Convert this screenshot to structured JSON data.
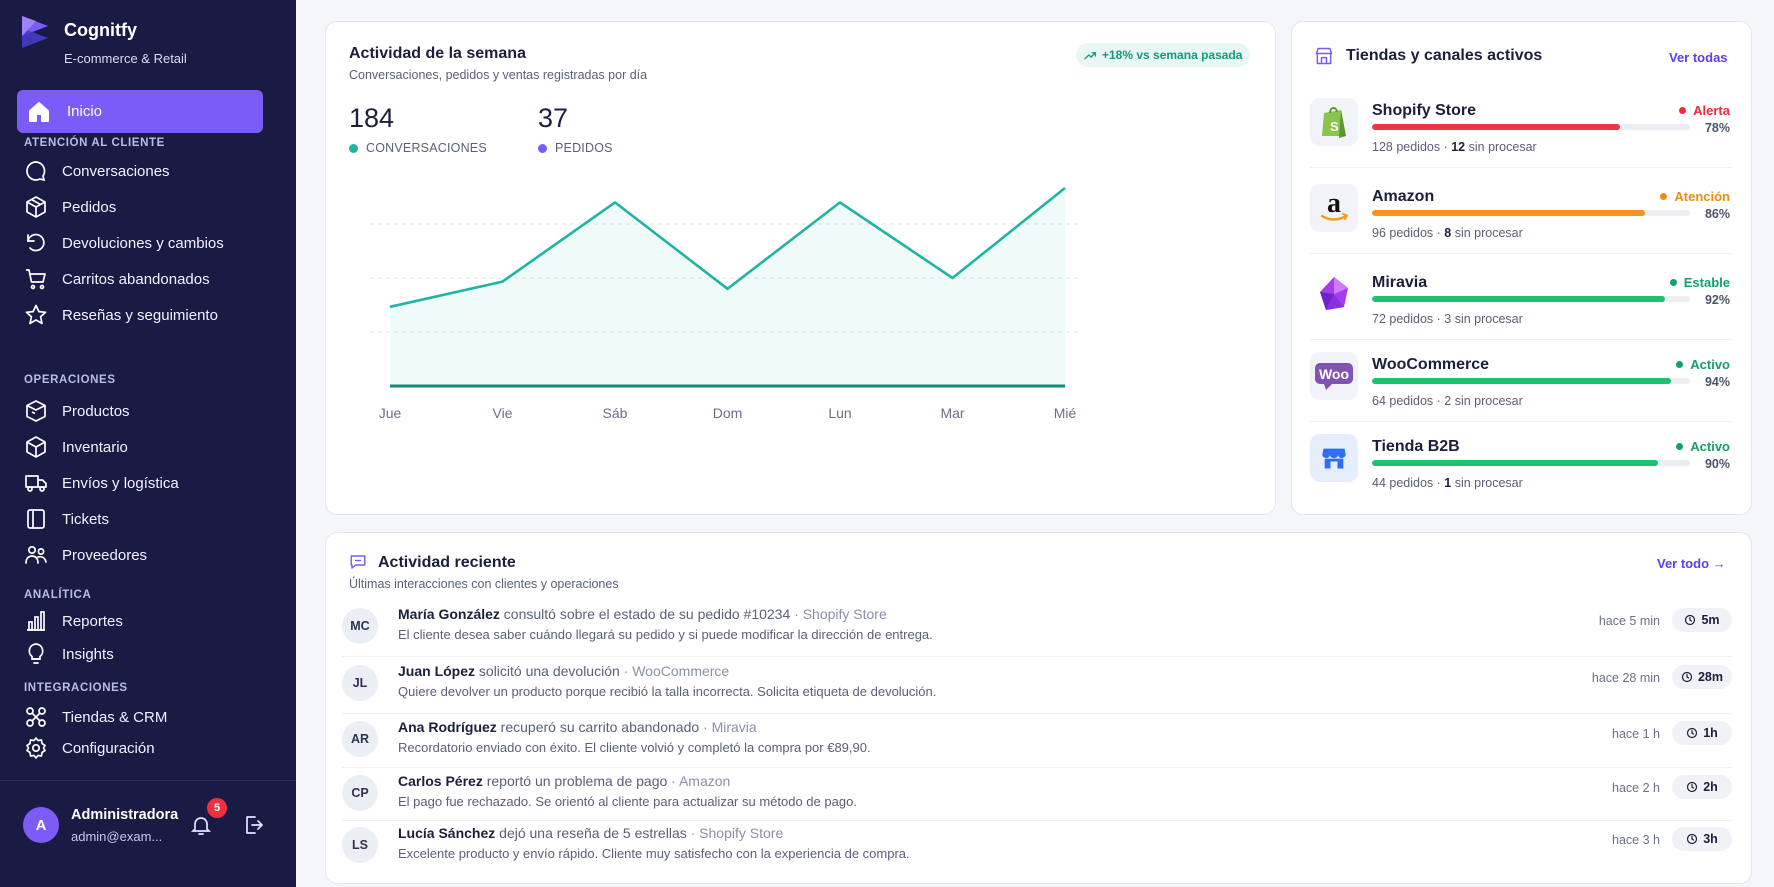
{
  "brand": {
    "name": "Cognitfy",
    "subtitle": "E-commerce & Retail"
  },
  "nav": {
    "active": {
      "label": "Inicio",
      "icon": "home-icon"
    },
    "sections": [
      {
        "title": "ATENCIÓN AL CLIENTE",
        "items": [
          {
            "label": "Conversaciones",
            "icon": "chat-icon"
          },
          {
            "label": "Pedidos",
            "icon": "box-icon"
          },
          {
            "label": "Devoluciones y cambios",
            "icon": "undo-icon"
          },
          {
            "label": "Carritos abandonados",
            "icon": "cart-icon"
          },
          {
            "label": "Reseñas y seguimiento",
            "icon": "star-icon"
          }
        ]
      },
      {
        "title": "OPERACIONES",
        "items": [
          {
            "label": "Productos",
            "icon": "package-icon"
          },
          {
            "label": "Inventario",
            "icon": "inventory-icon"
          },
          {
            "label": "Envíos y logística",
            "icon": "truck-icon"
          },
          {
            "label": "Tickets",
            "icon": "ticket-icon"
          },
          {
            "label": "Proveedores",
            "icon": "users-icon"
          }
        ]
      },
      {
        "title": "ANALÍTICA",
        "items": [
          {
            "label": "Reportes",
            "icon": "bar-chart-icon"
          },
          {
            "label": "Insights",
            "icon": "lightbulb-icon"
          }
        ]
      },
      {
        "title": "INTEGRACIONES",
        "items": [
          {
            "label": "Tiendas & CRM",
            "icon": "integrations-icon"
          },
          {
            "label": "Configuración",
            "icon": "gear-icon"
          }
        ]
      }
    ]
  },
  "user": {
    "initial": "A",
    "name": "Administradora",
    "email": "admin@exam...",
    "notifications": "5"
  },
  "weekly": {
    "title": "Actividad de la semana",
    "subtitle": "Conversaciones, pedidos y ventas registradas por día",
    "trend": "+18% vs semana pasada",
    "kpis": [
      {
        "value": "184",
        "label": "CONVERSACIONES",
        "color": "#1fb5a3"
      },
      {
        "value": "37",
        "label": "PEDIDOS",
        "color": "#7b5cf6"
      }
    ]
  },
  "chart_data": {
    "type": "area",
    "categories": [
      "Jue",
      "Vie",
      "Sáb",
      "Dom",
      "Lun",
      "Mar",
      "Mié"
    ],
    "series": [
      {
        "values": [
          22,
          29,
          51,
          27,
          51,
          30,
          55
        ],
        "color": "#1fb5a3"
      },
      {
        "values": [
          0,
          0,
          0,
          0,
          0,
          0,
          0
        ],
        "color": "#128c74"
      }
    ],
    "ylim": [
      0,
      60
    ],
    "grid": true
  },
  "stores": {
    "title": "Tiendas y canales activos",
    "link": "Ver todas",
    "items": [
      {
        "name": "Shopify Store",
        "status": "Alerta",
        "status_color": "#ef2b3a",
        "pct_label": "78%",
        "pct": 78,
        "bar_color": "#ef3446",
        "orders": "128 pedidos · ",
        "pending": "12",
        "pending_suffix": " sin procesar",
        "logo": "shopify-logo"
      },
      {
        "name": "Amazon",
        "status": "Atención",
        "status_color": "#f28a12",
        "pct_label": "86%",
        "pct": 86,
        "bar_color": "#f7931e",
        "orders": "96 pedidos · ",
        "pending": "8",
        "pending_suffix": " sin procesar",
        "logo": "amazon-logo"
      },
      {
        "name": "Miravia",
        "status": "Estable",
        "status_color": "#14a06a",
        "pct_label": "92%",
        "pct": 92,
        "bar_color": "#1ec16f",
        "orders": "72 pedidos · 3 sin procesar",
        "pending": "",
        "pending_suffix": "",
        "logo": "miravia-logo"
      },
      {
        "name": "WooCommerce",
        "status": "Activo",
        "status_color": "#14a06a",
        "pct_label": "94%",
        "pct": 94,
        "bar_color": "#1ec16f",
        "orders": "64 pedidos · 2 sin procesar",
        "pending": "",
        "pending_suffix": "",
        "logo": "woocommerce-logo"
      },
      {
        "name": "Tienda B2B",
        "status": "Activo",
        "status_color": "#14a06a",
        "pct_label": "90%",
        "pct": 90,
        "bar_color": "#1ec16f",
        "orders": "44 pedidos · ",
        "pending": "1",
        "pending_suffix": " sin procesar",
        "logo": "store-b2b-logo"
      }
    ]
  },
  "recent": {
    "title": "Actividad reciente",
    "subtitle": "Últimas interacciones con clientes y operaciones",
    "link": "Ver todo →",
    "items": [
      {
        "initials": "MC",
        "who": "María González",
        "action": " consultó sobre el estado de su pedido #10234",
        "source": " · Shopify Store",
        "detail": "El cliente desea saber cuándo llegará su pedido y si puede modificar la dirección de entrega.",
        "ago": "hace 5 min",
        "chip": "5m"
      },
      {
        "initials": "JL",
        "who": "Juan López",
        "action": " solicitó una devolución",
        "source": " · WooCommerce",
        "detail": "Quiere devolver un producto porque recibió la talla incorrecta. Solicita etiqueta de devolución.",
        "ago": "hace 28 min",
        "chip": "28m"
      },
      {
        "initials": "AR",
        "who": "Ana Rodríguez",
        "action": " recuperó su carrito abandonado",
        "source": " · Miravia",
        "detail": "Recordatorio enviado con éxito. El cliente volvió y completó la compra por €89,90.",
        "ago": "hace 1 h",
        "chip": "1h"
      },
      {
        "initials": "CP",
        "who": "Carlos Pérez",
        "action": " reportó un problema de pago",
        "source": " · Amazon",
        "detail": "El pago fue rechazado. Se orientó al cliente para actualizar su método de pago.",
        "ago": "hace 2 h",
        "chip": "2h"
      },
      {
        "initials": "LS",
        "who": "Lucía Sánchez",
        "action": " dejó una reseña de 5 estrellas",
        "source": " · Shopify Store",
        "detail": "Excelente producto y envío rápido. Cliente muy satisfecho con la experiencia de compra.",
        "ago": "hace 3 h",
        "chip": "3h"
      }
    ]
  }
}
